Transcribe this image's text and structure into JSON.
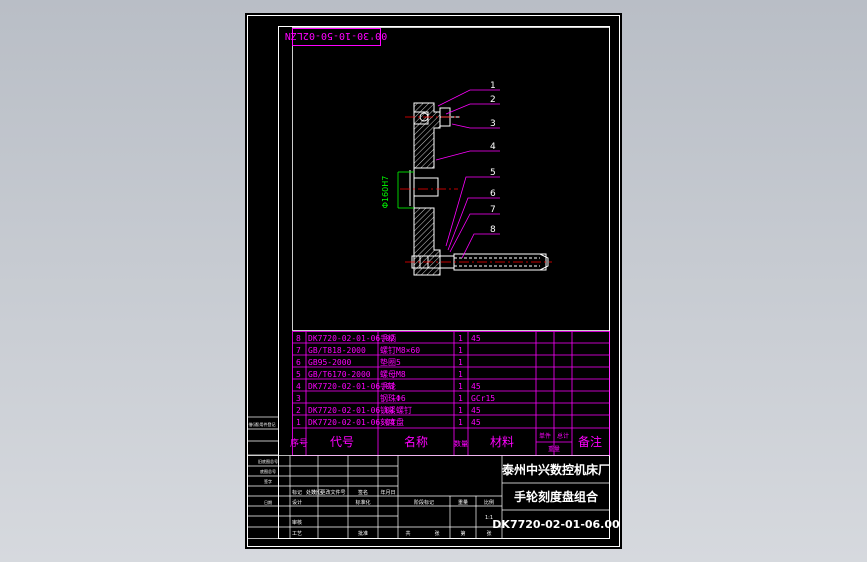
{
  "drawing": {
    "code_box": "00'30-10-50-02LZN",
    "dimension": "Φ160H7",
    "balloons": [
      "1",
      "2",
      "3",
      "4",
      "5",
      "6",
      "7",
      "8"
    ]
  },
  "bom": {
    "rows": [
      {
        "no": "8",
        "code": "DK7720-02-01-06.02",
        "name": "手柄",
        "qty": "1",
        "material": "45"
      },
      {
        "no": "7",
        "code": "GB/T818-2000",
        "name": "螺钉M8×60",
        "qty": "1",
        "material": ""
      },
      {
        "no": "6",
        "code": "GB95-2000",
        "name": "垫圈5",
        "qty": "1",
        "material": ""
      },
      {
        "no": "5",
        "code": "GB/T6170-2000",
        "name": "螺母M8",
        "qty": "1",
        "material": ""
      },
      {
        "no": "4",
        "code": "DK7720-02-01-06.03",
        "name": "手轮",
        "qty": "1",
        "material": "45"
      },
      {
        "no": "3",
        "code": "",
        "name": "钢珠Φ6",
        "qty": "1",
        "material": "GCr15"
      },
      {
        "no": "2",
        "code": "DK7720-02-01-06.01",
        "name": "锁紧螺钉",
        "qty": "1",
        "material": "45"
      },
      {
        "no": "1",
        "code": "DK7720-02-01-06.04",
        "name": "刻度盘",
        "qty": "1",
        "material": "45"
      }
    ],
    "header": {
      "no": "序号",
      "code": "代号",
      "name": "名称",
      "qty": "数量",
      "material": "材料",
      "single": "单件",
      "total": "总计",
      "weight": "重量",
      "remark": "备注"
    }
  },
  "title_block": {
    "company": "泰州中兴数控机床厂",
    "drawing_name": "手轮刻度盘组合",
    "drawing_no": "DK7720-02-01-06.00",
    "small_labels": [
      "标记",
      "处数",
      "分区",
      "更改文件号",
      "签名",
      "年月日",
      "设计",
      "标准化",
      "审核",
      "工艺",
      "批准",
      "阶段标记",
      "重量",
      "比例",
      "共",
      "张",
      "第",
      "张"
    ],
    "left_stub_labels": [
      "借(通)用件登记",
      "旧底图总号",
      "底图总号",
      "签字",
      "日期"
    ],
    "scale": "1:1"
  },
  "colors": {
    "frame": "#ffffff",
    "table": "#ff00ff",
    "drawing": "#ffffff",
    "centerline": "#ff0000",
    "dimension": "#00ff00",
    "leader": "#ff00ff",
    "background": "#000000"
  }
}
